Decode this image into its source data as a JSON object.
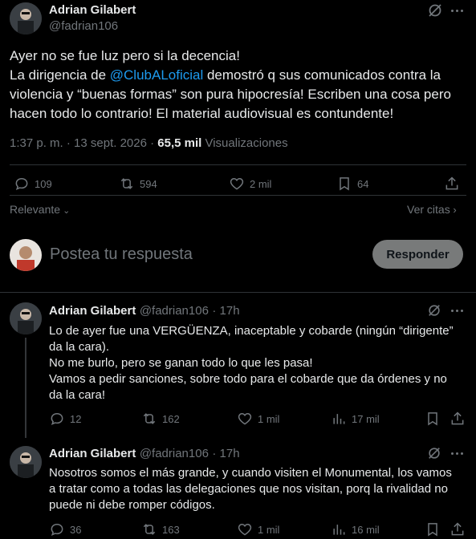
{
  "main_tweet": {
    "author_name": "Adrian Gilabert",
    "author_handle": "@fadrian106",
    "line1": "Ayer no se fue luz pero si la decencia!",
    "line2_pre": "La dirigencia de ",
    "line2_mention": "@ClubALoficial",
    "line2_post": " demostró q sus comunicados contra la",
    "line3": "violencia y “buenas formas” son pura hipocresía! Escriben una cosa pero",
    "line4": "hacen todo lo contrario! El material audiovisual es contundente!",
    "timestamp": "1:37 p. m. · 13 sept. 2026 · ",
    "views_count": "65,5 mil",
    "views_label": " Visualizaciones",
    "replies": "109",
    "reposts": "594",
    "likes": "2 mil",
    "bookmarks": "64"
  },
  "sort": {
    "relevant_label": "Relevante",
    "quotes_label": "Ver citas"
  },
  "composer": {
    "placeholder": "Postea tu respuesta",
    "button_label": "Responder"
  },
  "replies": [
    {
      "author_name": "Adrian Gilabert",
      "author_handle": "@fadrian106",
      "time": "· 17h",
      "lines": [
        "Lo de ayer fue una VERGÜENZA, inaceptable y cobarde (ningún “dirigente”",
        "da la cara).",
        "No me burlo, pero se ganan todo lo que les pasa!",
        "Vamos a pedir sanciones, sobre todo para el cobarde que da órdenes y no",
        "da la cara!"
      ],
      "replies": "12",
      "reposts": "162",
      "likes": "1 mil",
      "views": "17 mil"
    },
    {
      "author_name": "Adrian Gilabert",
      "author_handle": "@fadrian106",
      "time": "· 17h",
      "lines": [
        "Nosotros somos el más grande, y cuando visiten el Monumental, los vamos",
        "a tratar como a todas las delegaciones que nos visitan, porq la rivalidad no",
        "puede ni debe romper códigos."
      ],
      "replies": "36",
      "reposts": "163",
      "likes": "1 mil",
      "views": "16 mil"
    }
  ]
}
